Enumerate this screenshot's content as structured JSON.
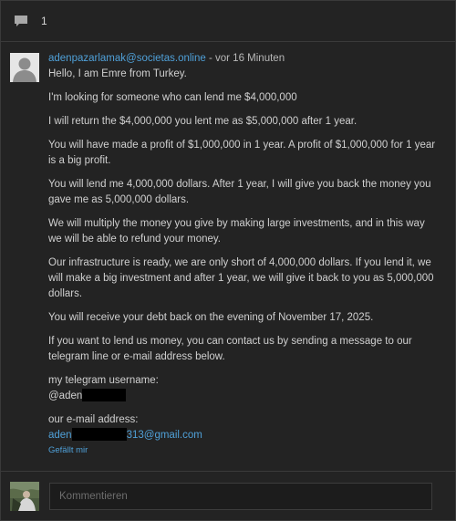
{
  "header": {
    "comment_icon": "speech-bubble-icon",
    "count": "1"
  },
  "comment": {
    "author": "adenpazarlamak@societas.online",
    "separator": " - ",
    "time": "vor 16 Minuten",
    "paragraphs": [
      "Hello, I am Emre from Turkey.",
      "I'm looking for someone who can lend me $4,000,000",
      "I will return the $4,000,000 you lent me as $5,000,000 after 1 year.",
      "You will have made a profit of $1,000,000 in 1 year. A profit of $1,000,000 for 1 year is a big profit.",
      "You will lend me 4,000,000 dollars. After 1 year, I will give you back the money you gave me as 5,000,000 dollars.",
      "We will multiply the money you give by making large investments, and in this way we will be able to refund your money.",
      "Our infrastructure is ready, we are only short of 4,000,000 dollars. If you lend it, we will make a big investment and after 1 year, we will give it back to you as 5,000,000 dollars.",
      "You will receive your debt back on the evening of November 17, 2025.",
      "If you want to lend us money, you can contact us by sending a message to our telegram line or e-mail address below."
    ],
    "telegram_label": "my telegram username:",
    "telegram_prefix": "@aden",
    "email_label": "our e-mail address:",
    "email_prefix": "aden",
    "email_suffix": "313@gmail.com",
    "like_label": "Gefällt mir"
  },
  "composer": {
    "placeholder": "Kommentieren"
  }
}
